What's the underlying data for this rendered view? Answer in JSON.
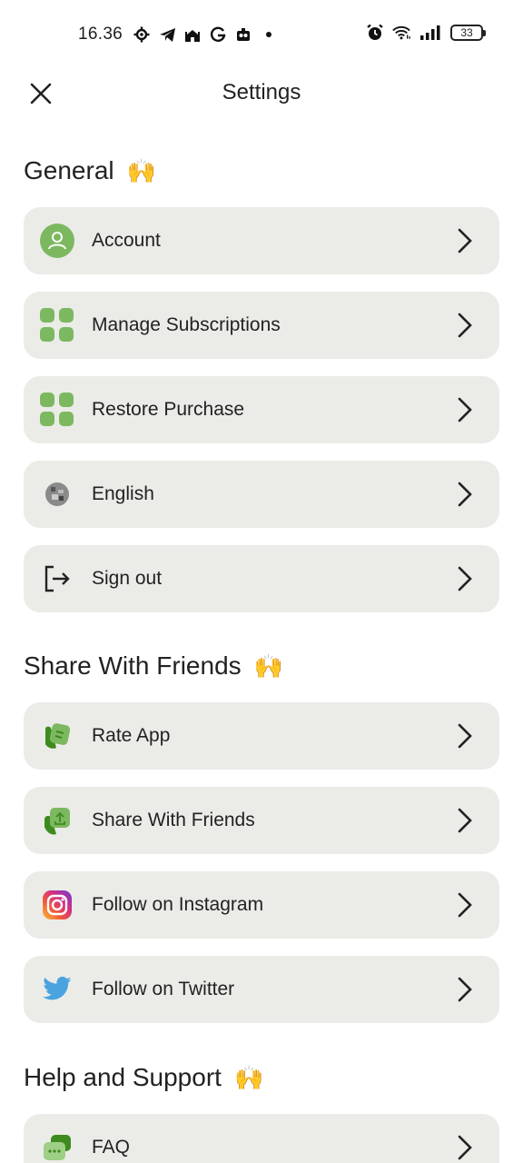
{
  "status_bar": {
    "time": "16.36",
    "battery": "33"
  },
  "header": {
    "title": "Settings"
  },
  "sections": {
    "general": {
      "title": "General",
      "emoji": "🙌",
      "items": [
        {
          "label": "Account",
          "icon": "account-icon"
        },
        {
          "label": "Manage Subscriptions",
          "icon": "grid-icon"
        },
        {
          "label": "Restore Purchase",
          "icon": "grid-icon"
        },
        {
          "label": "English",
          "icon": "language-icon"
        },
        {
          "label": "Sign out",
          "icon": "sign-out-icon"
        }
      ]
    },
    "share": {
      "title": "Share With Friends",
      "emoji": "🙌",
      "items": [
        {
          "label": "Rate App",
          "icon": "rate-icon"
        },
        {
          "label": "Share With Friends",
          "icon": "share-icon"
        },
        {
          "label": "Follow on Instagram",
          "icon": "instagram-icon"
        },
        {
          "label": "Follow on Twitter",
          "icon": "twitter-icon"
        }
      ]
    },
    "help": {
      "title": "Help and Support",
      "emoji": "🙌",
      "items": [
        {
          "label": "FAQ",
          "icon": "faq-icon"
        }
      ]
    }
  },
  "colors": {
    "accent_green": "#7cb860",
    "row_bg": "#ebece8",
    "twitter": "#1da1f2"
  }
}
